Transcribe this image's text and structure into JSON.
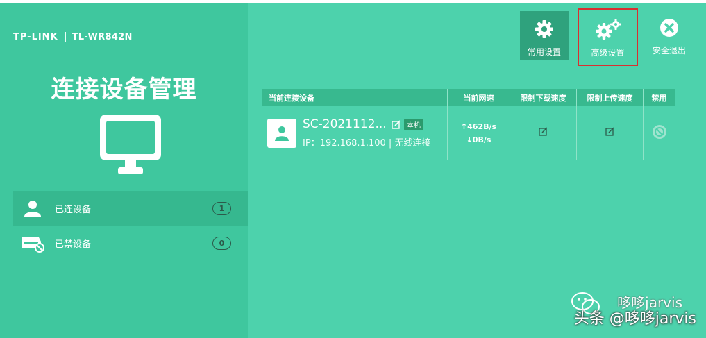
{
  "brand": {
    "logo": "TP-LINK",
    "model": "TL-WR842N"
  },
  "sidebar": {
    "title": "连接设备管理",
    "items": [
      {
        "label": "已连设备",
        "count": "1",
        "icon": "user-icon",
        "active": true
      },
      {
        "label": "已禁设备",
        "count": "0",
        "icon": "blocked-device-icon",
        "active": false
      }
    ]
  },
  "toolbar": {
    "basic_label": "常用设置",
    "advanced_label": "高级设置",
    "logout_label": "安全退出"
  },
  "table": {
    "headers": [
      "当前连接设备",
      "当前网速",
      "限制下载速度",
      "限制上传速度",
      "禁用"
    ],
    "rows": [
      {
        "name": "SC-2021112...",
        "badge": "本机",
        "ip": "IP：192.168.1.100 | 无线连接",
        "upload": "↑462B/s",
        "download": "↓0B/s"
      }
    ]
  },
  "watermark": {
    "line1": "哆哆jarvis",
    "line2": "头条 @哆哆jarvis"
  },
  "colors": {
    "background": "#4dd2ac",
    "sidebar": "#3fc79e",
    "highlight": "#d93030"
  }
}
